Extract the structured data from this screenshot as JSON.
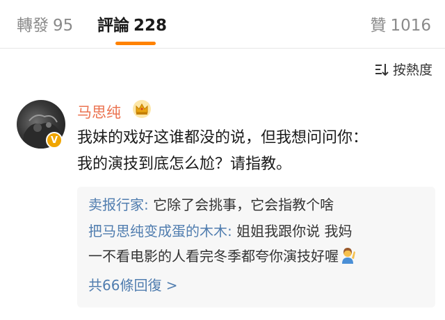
{
  "tabs": [
    {
      "label": "轉發",
      "count": "95"
    },
    {
      "label": "評論",
      "count": "228"
    },
    {
      "label": "贊",
      "count": "1016"
    }
  ],
  "sort": {
    "label": "按熱度",
    "icon": "sort-icon"
  },
  "comment": {
    "username": "马思纯",
    "badge": "V",
    "badge_icon": "crown-icon",
    "lines": [
      "我妹的戏好这谁都没的说，但我想问问你：",
      "我的演技到底怎么尬？请指教。"
    ]
  },
  "replies": [
    {
      "author": "卖报行家:",
      "text": "它除了会挑事，它会指教个啥"
    },
    {
      "author": "把马思纯变成蛋的木木:",
      "text": "姐姐我跟你说 我妈",
      "text2": "一不看电影的人看完冬季都夸你演技好喔",
      "emoji": "person-raising-hand-icon"
    }
  ],
  "more_replies": "共66條回復 >",
  "colors": {
    "accent": "#ff8200",
    "username": "#eb7350",
    "link": "#507daf"
  }
}
